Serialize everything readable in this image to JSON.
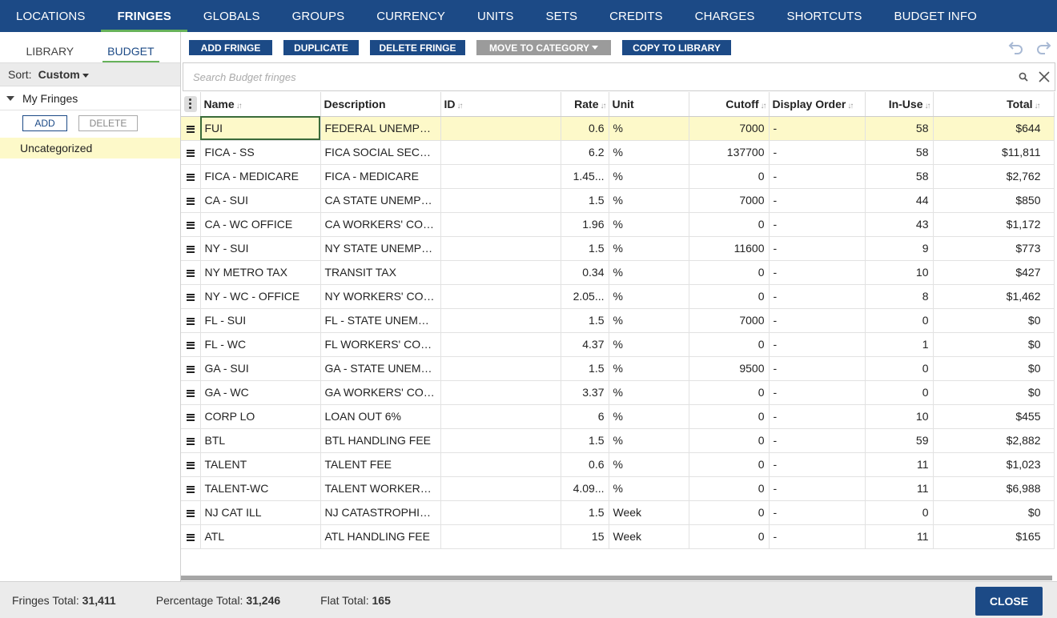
{
  "nav": {
    "tabs": [
      {
        "label": "LOCATIONS"
      },
      {
        "label": "FRINGES"
      },
      {
        "label": "GLOBALS"
      },
      {
        "label": "GROUPS"
      },
      {
        "label": "CURRENCY"
      },
      {
        "label": "UNITS"
      },
      {
        "label": "SETS"
      },
      {
        "label": "CREDITS"
      },
      {
        "label": "CHARGES"
      },
      {
        "label": "SHORTCUTS"
      },
      {
        "label": "BUDGET INFO"
      }
    ],
    "active": "FRINGES"
  },
  "left": {
    "subtabs": [
      "LIBRARY",
      "BUDGET"
    ],
    "active_subtab": "BUDGET",
    "sort_label": "Sort:",
    "sort_value": "Custom",
    "group_label": "My Fringes",
    "add_label": "ADD",
    "delete_label": "DELETE",
    "category": "Uncategorized"
  },
  "toolbar": {
    "add_fringe": "ADD FRINGE",
    "duplicate": "DUPLICATE",
    "delete_fringe": "DELETE FRINGE",
    "move_to_category": "MOVE TO CATEGORY",
    "copy_to_library": "COPY TO LIBRARY",
    "undo_icon": "undo-icon",
    "redo_icon": "redo-icon"
  },
  "search": {
    "placeholder": "Search Budget fringes",
    "value": ""
  },
  "table": {
    "columns": {
      "name": "Name",
      "description": "Description",
      "id": "ID",
      "rate": "Rate",
      "unit": "Unit",
      "cutoff": "Cutoff",
      "display_order": "Display Order",
      "in_use": "In-Use",
      "total": "Total"
    },
    "rows": [
      {
        "name": "FUI",
        "description": "FEDERAL UNEMPLOYMENT",
        "id": "",
        "rate": "0.6",
        "unit": "%",
        "cutoff": "7000",
        "display_order": "-",
        "in_use": "58",
        "total": "$644"
      },
      {
        "name": "FICA - SS",
        "description": "FICA SOCIAL SECURITY",
        "id": "",
        "rate": "6.2",
        "unit": "%",
        "cutoff": "137700",
        "display_order": "-",
        "in_use": "58",
        "total": "$11,811"
      },
      {
        "name": "FICA - MEDICARE",
        "description": "FICA - MEDICARE",
        "id": "",
        "rate": "1.45...",
        "unit": "%",
        "cutoff": "0",
        "display_order": "-",
        "in_use": "58",
        "total": "$2,762"
      },
      {
        "name": "CA - SUI",
        "description": "CA STATE UNEMPLOYMENT",
        "id": "",
        "rate": "1.5",
        "unit": "%",
        "cutoff": "7000",
        "display_order": "-",
        "in_use": "44",
        "total": "$850"
      },
      {
        "name": "CA - WC OFFICE",
        "description": "CA WORKERS' COMP OFFICE",
        "id": "",
        "rate": "1.96",
        "unit": "%",
        "cutoff": "0",
        "display_order": "-",
        "in_use": "43",
        "total": "$1,172"
      },
      {
        "name": "NY - SUI",
        "description": "NY STATE UNEMPLOYMENT",
        "id": "",
        "rate": "1.5",
        "unit": "%",
        "cutoff": "11600",
        "display_order": "-",
        "in_use": "9",
        "total": "$773"
      },
      {
        "name": "NY METRO TAX",
        "description": "TRANSIT TAX",
        "id": "",
        "rate": "0.34",
        "unit": "%",
        "cutoff": "0",
        "display_order": "-",
        "in_use": "10",
        "total": "$427"
      },
      {
        "name": "NY - WC - OFFICE",
        "description": "NY WORKERS' COMP OFFICE",
        "id": "",
        "rate": "2.05...",
        "unit": "%",
        "cutoff": "0",
        "display_order": "-",
        "in_use": "8",
        "total": "$1,462"
      },
      {
        "name": "FL - SUI",
        "description": "FL - STATE UNEMPLOYMENT",
        "id": "",
        "rate": "1.5",
        "unit": "%",
        "cutoff": "7000",
        "display_order": "-",
        "in_use": "0",
        "total": "$0"
      },
      {
        "name": "FL - WC",
        "description": "FL WORKERS' COMP",
        "id": "",
        "rate": "4.37",
        "unit": "%",
        "cutoff": "0",
        "display_order": "-",
        "in_use": "1",
        "total": "$0"
      },
      {
        "name": "GA - SUI",
        "description": "GA - STATE UNEMPLOYMENT",
        "id": "",
        "rate": "1.5",
        "unit": "%",
        "cutoff": "9500",
        "display_order": "-",
        "in_use": "0",
        "total": "$0"
      },
      {
        "name": "GA - WC",
        "description": "GA WORKERS' COMP",
        "id": "",
        "rate": "3.37",
        "unit": "%",
        "cutoff": "0",
        "display_order": "-",
        "in_use": "0",
        "total": "$0"
      },
      {
        "name": "CORP LO",
        "description": "LOAN OUT 6%",
        "id": "",
        "rate": "6",
        "unit": "%",
        "cutoff": "0",
        "display_order": "-",
        "in_use": "10",
        "total": "$455"
      },
      {
        "name": "BTL",
        "description": "BTL HANDLING FEE",
        "id": "",
        "rate": "1.5",
        "unit": "%",
        "cutoff": "0",
        "display_order": "-",
        "in_use": "59",
        "total": "$2,882"
      },
      {
        "name": "TALENT",
        "description": "TALENT FEE",
        "id": "",
        "rate": "0.6",
        "unit": "%",
        "cutoff": "0",
        "display_order": "-",
        "in_use": "11",
        "total": "$1,023"
      },
      {
        "name": "TALENT-WC",
        "description": "TALENT WORKERS' COMP",
        "id": "",
        "rate": "4.09...",
        "unit": "%",
        "cutoff": "0",
        "display_order": "-",
        "in_use": "11",
        "total": "$6,988"
      },
      {
        "name": "NJ CAT ILL",
        "description": "NJ CATASTROPHIC ILLNESS",
        "id": "",
        "rate": "1.5",
        "unit": "Week",
        "cutoff": "0",
        "display_order": "-",
        "in_use": "0",
        "total": "$0"
      },
      {
        "name": "ATL",
        "description": "ATL HANDLING FEE",
        "id": "",
        "rate": "15",
        "unit": "Week",
        "cutoff": "0",
        "display_order": "-",
        "in_use": "11",
        "total": "$165"
      }
    ]
  },
  "footer": {
    "fringes_total_label": "Fringes Total:",
    "fringes_total": "31,411",
    "percentage_total_label": "Percentage Total:",
    "percentage_total": "31,246",
    "flat_total_label": "Flat Total:",
    "flat_total": "165",
    "close_label": "CLOSE"
  },
  "colors": {
    "primary": "#1c4a86",
    "accent": "#66b25a",
    "selected_row": "#fdf9c9",
    "disabled_button": "#9b9b9b"
  }
}
